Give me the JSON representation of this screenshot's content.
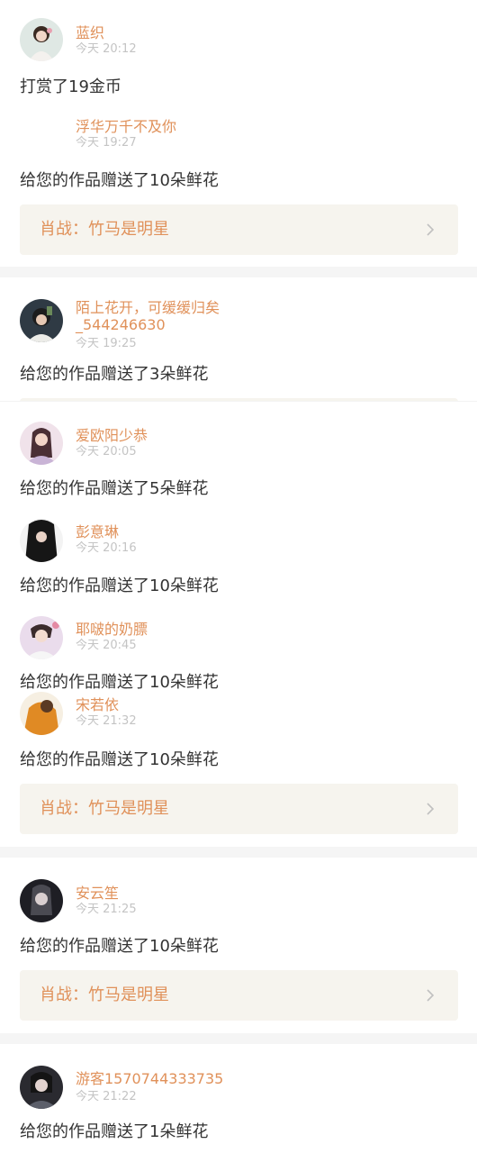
{
  "colors": {
    "accent": "#e0915a",
    "muted": "#c4c4c4",
    "text": "#333333",
    "work_bg": "#f6f4ee",
    "separator": "#f5f5f5"
  },
  "icons": {
    "chevron": "chevron-right-icon"
  },
  "card1": {
    "e1": {
      "name": "蓝织",
      "time": "今天 20:12",
      "message": "打赏了19金币"
    },
    "e2": {
      "name": "浮华万千不及你",
      "time": "今天 19:27",
      "message": "给您的作品赠送了10朵鲜花"
    },
    "work": {
      "title": "肖战：竹马是明星"
    }
  },
  "card2": {
    "e1": {
      "name_line1": "陌上花开，可缓缓归矣",
      "name_line2": "_544246630",
      "time": "今天 19:25",
      "message": "给您的作品赠送了3朵鲜花"
    }
  },
  "card3": {
    "e1": {
      "name": "爱欧阳少恭",
      "time": "今天 20:05",
      "message": "给您的作品赠送了5朵鲜花"
    },
    "e2": {
      "name": "彭意琳",
      "time": "今天 20:16",
      "message": "给您的作品赠送了10朵鲜花"
    },
    "e3": {
      "name": "耶啵的奶膘",
      "time": "今天 20:45",
      "message": "给您的作品赠送了10朵鲜花"
    },
    "e4": {
      "name": "宋若依",
      "time": "今天 21:32",
      "message": "给您的作品赠送了10朵鲜花"
    },
    "work": {
      "title": "肖战：竹马是明星"
    }
  },
  "card4": {
    "e1": {
      "name": "安云笙",
      "time": "今天 21:25",
      "message": "给您的作品赠送了10朵鲜花"
    },
    "work": {
      "title": "肖战：竹马是明星"
    }
  },
  "card5": {
    "e1": {
      "name": "游客1570744333735",
      "time": "今天 21:22",
      "message": "给您的作品赠送了1朵鲜花"
    }
  }
}
